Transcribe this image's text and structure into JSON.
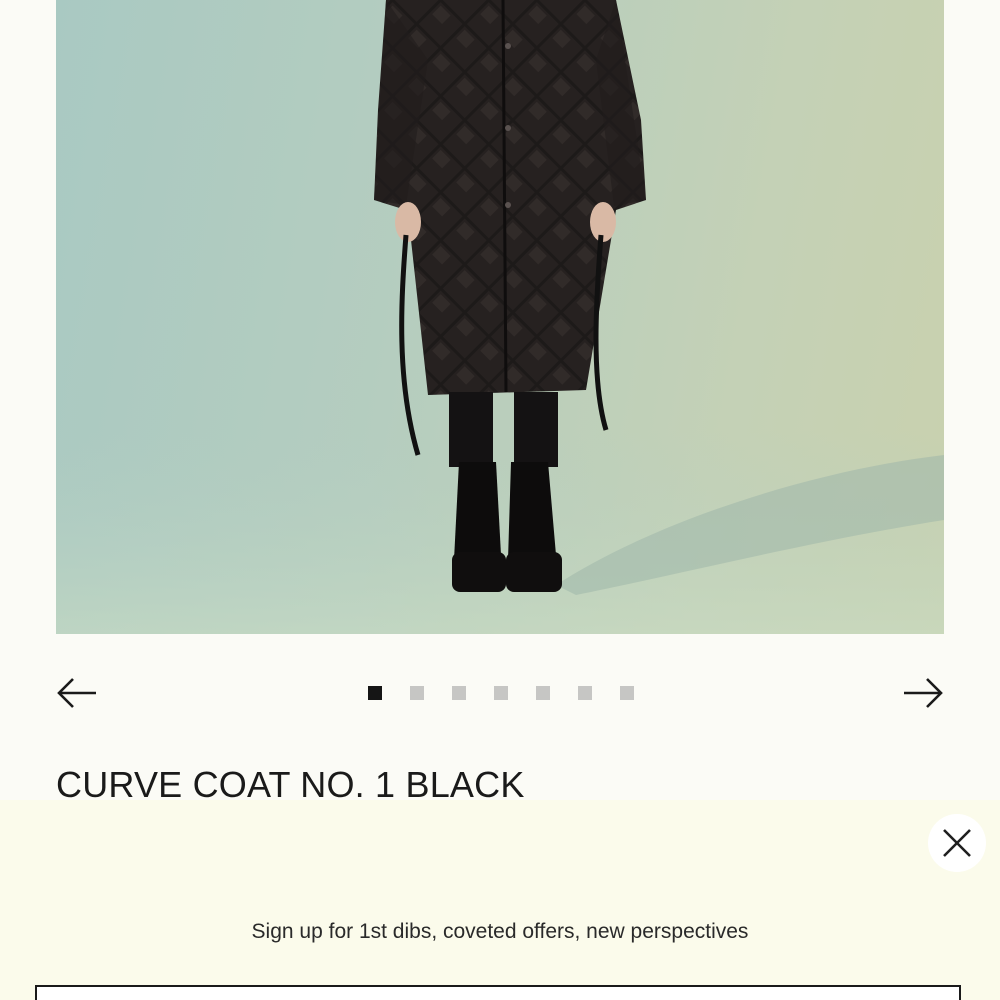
{
  "product": {
    "title": "CURVE COAT NO. 1 BLACK",
    "image_alt": "Model wearing quilted black coat"
  },
  "carousel": {
    "prev_icon": "arrow-left-icon",
    "next_icon": "arrow-right-icon",
    "slide_count": 7,
    "active_index": 0
  },
  "signup": {
    "message": "Sign up for 1st dibs, coveted offers, new perspectives",
    "email_value": "",
    "close_icon": "close-icon"
  },
  "colors": {
    "background": "#fbfbf6",
    "sheet_background": "#fbfbeb",
    "dot_active": "#151515",
    "dot_inactive": "#c6c6c4"
  }
}
